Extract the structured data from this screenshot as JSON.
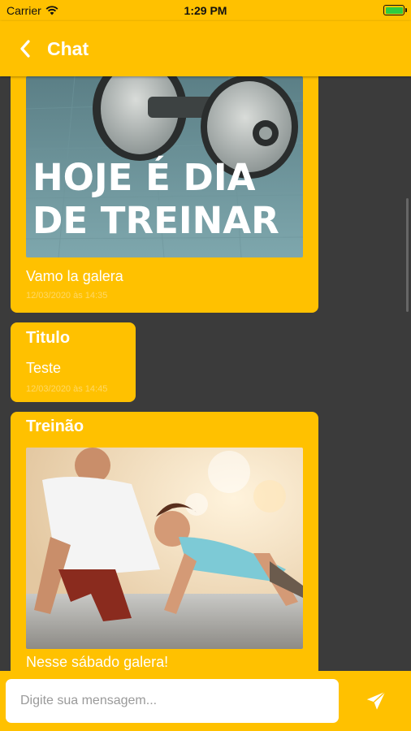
{
  "status_bar": {
    "carrier": "Carrier",
    "time": "1:29 PM",
    "wifi_icon": "wifi-icon",
    "battery_icon": "battery-icon"
  },
  "header": {
    "title": "Chat",
    "back_icon": "chevron-left-icon"
  },
  "messages": [
    {
      "title": "",
      "image_caption": "HOJE É DIA DE TREINAR",
      "image_lines": [
        "HOJE É DIA",
        "DE TREINAR"
      ],
      "text": "Vamo la galera",
      "date": "12/03/2020 às 14:35"
    },
    {
      "title": "Titulo",
      "text": "Teste",
      "date": "12/03/2020 às 14:45"
    },
    {
      "title": "Treinão",
      "image_description": "workout-photo",
      "text": "Nesse sábado galera!"
    }
  ],
  "composer": {
    "placeholder": "Digite sua mensagem...",
    "value": "",
    "send_icon": "send-icon"
  },
  "colors": {
    "accent": "#ffc100",
    "background": "#3b3b3b",
    "text_on_accent": "#ffffff"
  }
}
